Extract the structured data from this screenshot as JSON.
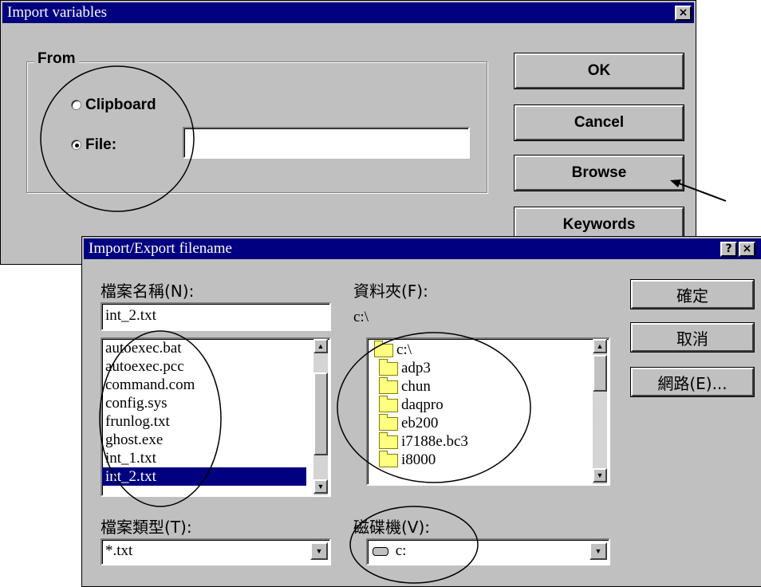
{
  "import_dialog": {
    "title": "Import variables",
    "close_glyph": "×",
    "from_group": "From",
    "clipboard_label": "Clipboard",
    "file_label": "File:",
    "file_value": "",
    "ok_label": "OK",
    "cancel_label": "Cancel",
    "browse_label": "Browse",
    "keywords_label": "Keywords"
  },
  "file_dialog": {
    "title": "Import/Export filename",
    "help_glyph": "?",
    "close_glyph": "×",
    "filename_label": "檔案名稱(N):",
    "filename_value": "int_2.txt",
    "files": [
      "autoexec.bat",
      "autoexec.pcc",
      "command.com",
      "config.sys",
      "frunlog.txt",
      "ghost.exe",
      "int_1.txt",
      "int_2.txt"
    ],
    "selected_file": "int_2.txt",
    "folder_label": "資料夾(F):",
    "current_folder": "c:\\",
    "folders": [
      "c:\\",
      "adp3",
      "chun",
      "daqpro",
      "eb200",
      "i7188e.bc3",
      "i8000"
    ],
    "filetype_label": "檔案類型(T):",
    "filetype_value": "*.txt",
    "drive_label": "磁碟機(V):",
    "drive_value": "c:",
    "ok_label": "確定",
    "cancel_label": "取消",
    "network_label": "網路(E)..."
  },
  "colors": {
    "titlebar": "#000080",
    "face": "#c0c0c0",
    "selection": "#000080"
  }
}
